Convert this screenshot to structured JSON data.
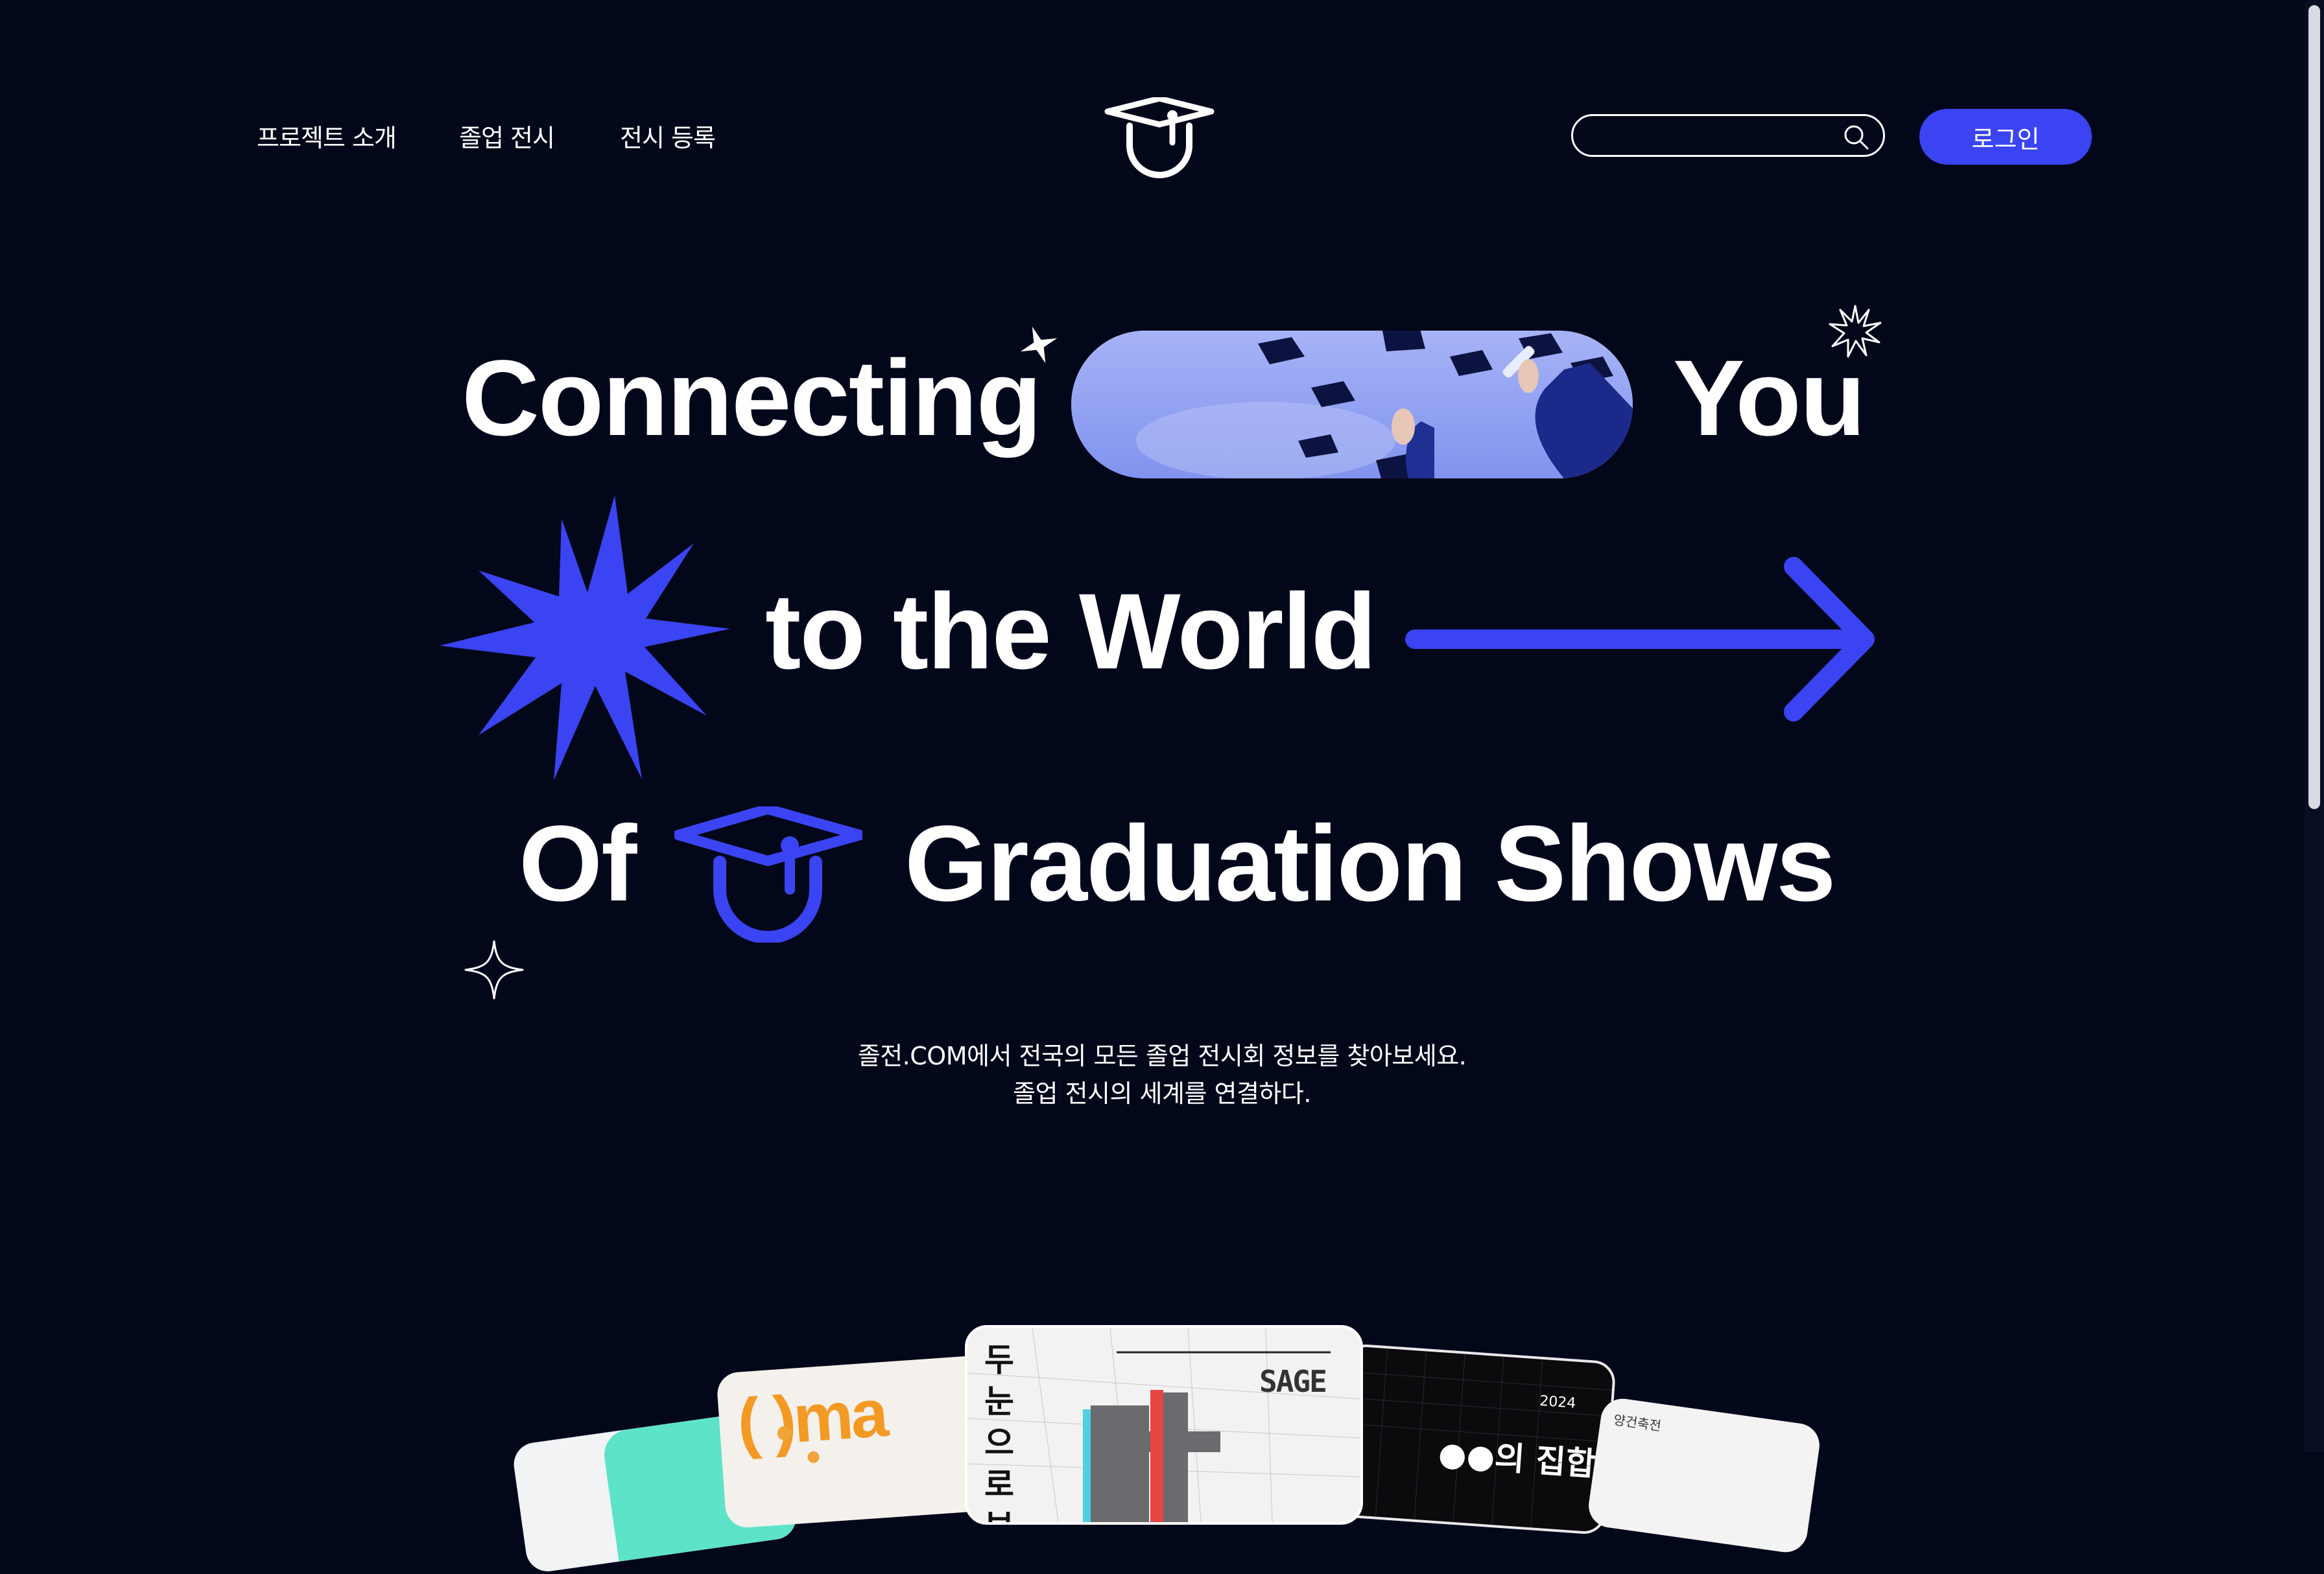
{
  "header": {
    "nav": [
      {
        "label": "프로젝트 소개"
      },
      {
        "label": "졸업 전시"
      },
      {
        "label": "전시 등록"
      }
    ],
    "logo_icon": "graduation-cap-logo",
    "search": {
      "value": "",
      "placeholder": "",
      "icon": "search-icon"
    },
    "login_label": "로그인"
  },
  "hero": {
    "line1_word1": "Connecting",
    "line1_word2": "You",
    "line2": "to the World",
    "line3_word1": "Of",
    "line3_word2": "Graduation Shows"
  },
  "subtitle": {
    "line1": "졸전.COM에서 전국의 모든 졸업 전시회 정보를 찾아보세요.",
    "line2": "졸업 전시의 세계를 연결하다."
  },
  "posters": {
    "left_text": "( )ma",
    "center_text": "두 눈으로 보기",
    "center_badge": "SAGE",
    "right_year": "2024",
    "right_title": "●●의 집합",
    "far_right_text": "양건축전"
  },
  "colors": {
    "background": "#03071a",
    "accent": "#3a44f2",
    "text": "#ffffff"
  }
}
